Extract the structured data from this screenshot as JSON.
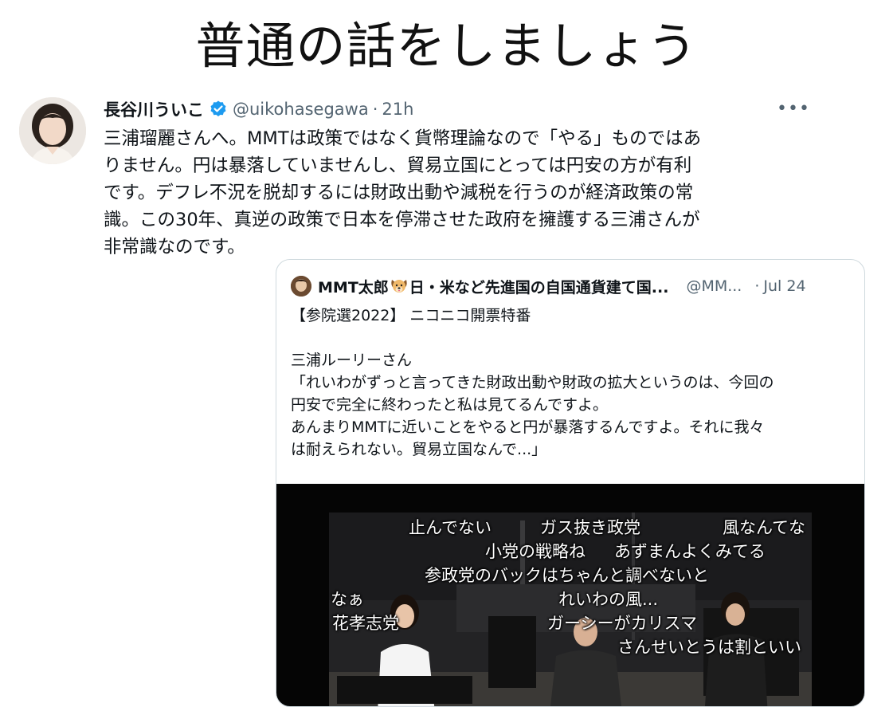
{
  "slide": {
    "title": "普通の話をしましょう"
  },
  "tweet": {
    "author_name": "長谷川ういこ",
    "handle": "@uikohasegawa",
    "separator": "·",
    "time": "21h",
    "more": "•••",
    "verified": true,
    "text_lines": [
      "三浦瑠麗さんへ。MMTは政策ではなく貨幣理論なので「やる」ものではあ",
      "りません。円は暴落していませんし、貿易立国にとっては円安の方が有利",
      "です。デフレ不況を脱却するには財政出動や減税を行うのが経済政策の常",
      "識。この30年、真逆の政策で日本を停滞させた政府を擁護する三浦さんが",
      "非常識なのです。"
    ]
  },
  "quote": {
    "author_name_prefix": "MMT太郎",
    "author_name_suffix": "日・米など先進国の自国通貨建て国...",
    "handle": "@MM...",
    "separator": "·",
    "time": "Jul 24",
    "text_lines": [
      "【参院選2022】 ニコニコ開票特番",
      "",
      "三浦ルーリーさん",
      "「れいわがずっと言ってきた財政出動や財政の拡大というのは、今回の",
      "円安で完全に終わったと私は見てるんですよ。",
      "あんまりMMTに近いことをやると円が暴落するんですよ。それに我々",
      "は耐えられない。貿易立国なんで...」"
    ]
  },
  "video": {
    "captions": [
      "止んでない",
      "ガス抜き政党",
      "風なんてな",
      "小党の戦略ね",
      "あずまんよくみてる",
      "参政党のバックはちゃんと調べないと",
      "なぁ",
      "れいわの風...",
      "花孝志党",
      "ガーシーがカリスマ",
      "さんせいとうは割といい"
    ]
  },
  "colors": {
    "verified": "#1d9bf0",
    "secondary_text": "#536471",
    "border": "#cfd9de"
  }
}
